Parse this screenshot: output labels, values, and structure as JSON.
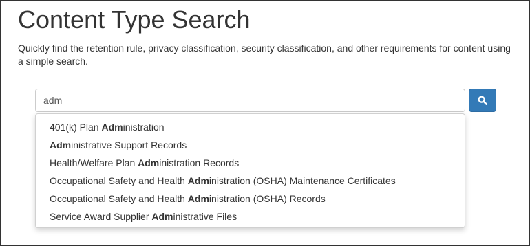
{
  "header": {
    "title": "Content Type Search",
    "description": "Quickly find the retention rule, privacy classification, security classification, and other requirements for content using a simple search."
  },
  "search": {
    "value": "adm",
    "button_icon": "search-icon",
    "button_color": "#337ab7"
  },
  "suggestions": [
    {
      "before": "401(k) Plan ",
      "match": "Adm",
      "after": "inistration"
    },
    {
      "before": "",
      "match": "Adm",
      "after": "inistrative Support Records"
    },
    {
      "before": "Health/Welfare Plan ",
      "match": "Adm",
      "after": "inistration Records"
    },
    {
      "before": "Occupational Safety and Health ",
      "match": "Adm",
      "after": "inistration (OSHA) Maintenance Certificates"
    },
    {
      "before": "Occupational Safety and Health ",
      "match": "Adm",
      "after": "inistration (OSHA) Records"
    },
    {
      "before": "Service Award Supplier ",
      "match": "Adm",
      "after": "inistrative Files"
    }
  ]
}
